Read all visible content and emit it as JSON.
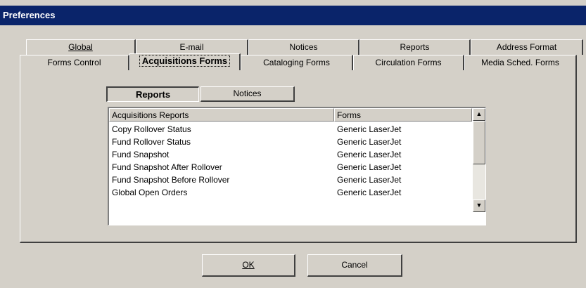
{
  "window": {
    "title": "Preferences"
  },
  "tabs_back": [
    {
      "label": "Global"
    },
    {
      "label": "E-mail"
    },
    {
      "label": "Notices"
    },
    {
      "label": "Reports"
    },
    {
      "label": "Address Format"
    }
  ],
  "tabs_front": [
    {
      "label": "Forms Control"
    },
    {
      "label": "Acquisitions Forms"
    },
    {
      "label": "Cataloging Forms"
    },
    {
      "label": "Circulation Forms"
    },
    {
      "label": "Media Sched. Forms"
    }
  ],
  "subtabs": {
    "reports": "Reports",
    "notices": "Notices"
  },
  "list": {
    "columns": [
      "Acquisitions Reports",
      "Forms"
    ],
    "rows": [
      [
        "Copy Rollover Status",
        "Generic LaserJet"
      ],
      [
        "Fund Rollover Status",
        "Generic LaserJet"
      ],
      [
        "Fund Snapshot",
        "Generic LaserJet"
      ],
      [
        "Fund Snapshot After Rollover",
        "Generic LaserJet"
      ],
      [
        "Fund Snapshot Before Rollover",
        "Generic LaserJet"
      ],
      [
        "Global Open Orders",
        "Generic LaserJet"
      ]
    ]
  },
  "buttons": {
    "ok": "OK",
    "cancel": "Cancel"
  }
}
